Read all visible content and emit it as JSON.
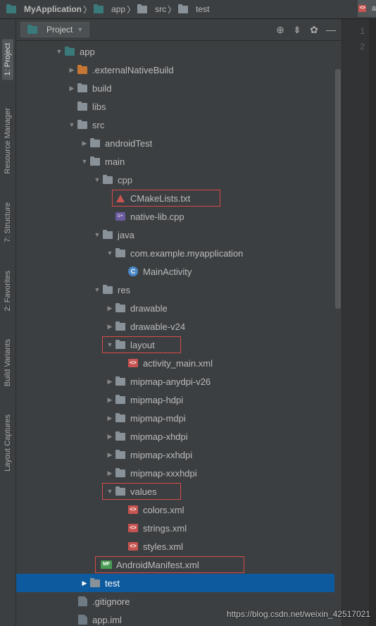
{
  "breadcrumbs": [
    "MyApplication",
    "app",
    "src",
    "test"
  ],
  "panel": {
    "view": "Project"
  },
  "sidebar": {
    "project": "1: Project",
    "resmgr": "Resource Manager",
    "structure": "7: Structure",
    "favorites": "2: Favorites",
    "buildvar": "Build Variants",
    "captures": "Layout Captures"
  },
  "tree": {
    "app": "app",
    "externalNativeBuild": ".externalNativeBuild",
    "build": "build",
    "libs": "libs",
    "src": "src",
    "androidTest": "androidTest",
    "main": "main",
    "cpp": "cpp",
    "cmakelists": "CMakeLists.txt",
    "nativelib": "native-lib.cpp",
    "java": "java",
    "package": "com.example.myapplication",
    "mainactivity": "MainActivity",
    "res": "res",
    "drawable": "drawable",
    "drawablev24": "drawable-v24",
    "layout": "layout",
    "activitymain": "activity_main.xml",
    "mipmapany": "mipmap-anydpi-v26",
    "mipmaphdpi": "mipmap-hdpi",
    "mipmapmdpi": "mipmap-mdpi",
    "mipmapxhdpi": "mipmap-xhdpi",
    "mipmapxxhdpi": "mipmap-xxhdpi",
    "mipmapxxxhdpi": "mipmap-xxxhdpi",
    "values": "values",
    "colorsxml": "colors.xml",
    "stringsxml": "strings.xml",
    "stylesxml": "styles.xml",
    "manifest": "AndroidManifest.xml",
    "test": "test",
    "gitignore": ".gitignore",
    "appiml": "app.iml"
  },
  "gutter": {
    "l1": "1",
    "l2": "2"
  },
  "editorTab": "a",
  "watermark": "https://blog.csdn.net/weixin_42517021"
}
